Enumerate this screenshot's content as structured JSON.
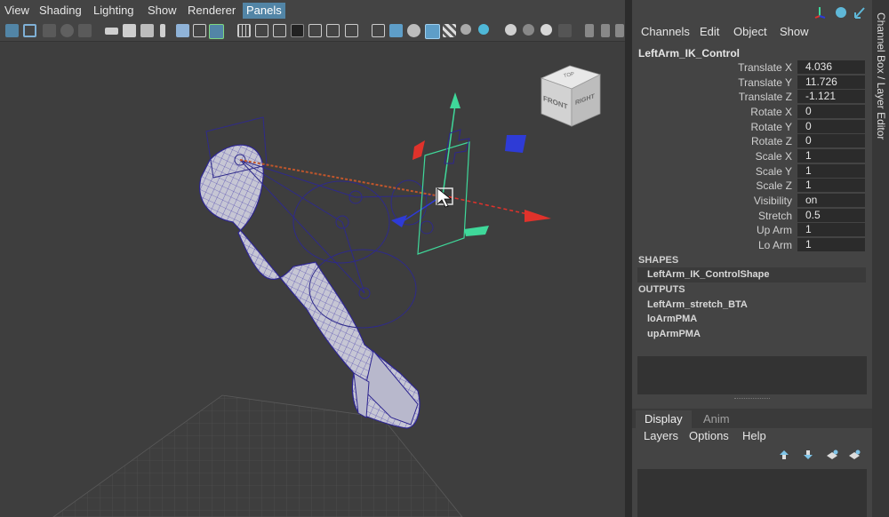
{
  "viewport": {
    "menus": [
      "View",
      "Shading",
      "Lighting",
      "Show",
      "Renderer",
      "Panels"
    ],
    "active_menu": "Panels",
    "view_cube": {
      "top": "TOP",
      "front": "FRONT",
      "right": "RIGHT"
    }
  },
  "channel_box": {
    "side_tab": "Channel Box / Layer Editor",
    "menus": [
      "Channels",
      "Edit",
      "Object",
      "Show"
    ],
    "object_name": "LeftArm_IK_Control",
    "attributes": [
      {
        "label": "Translate X",
        "value": "4.036"
      },
      {
        "label": "Translate Y",
        "value": "11.726"
      },
      {
        "label": "Translate Z",
        "value": "-1.121"
      },
      {
        "label": "Rotate X",
        "value": "0"
      },
      {
        "label": "Rotate Y",
        "value": "0"
      },
      {
        "label": "Rotate Z",
        "value": "0"
      },
      {
        "label": "Scale X",
        "value": "1"
      },
      {
        "label": "Scale Y",
        "value": "1"
      },
      {
        "label": "Scale Z",
        "value": "1"
      },
      {
        "label": "Visibility",
        "value": "on"
      },
      {
        "label": "Stretch",
        "value": "0.5"
      },
      {
        "label": "Up Arm",
        "value": "1"
      },
      {
        "label": "Lo Arm",
        "value": "1"
      }
    ],
    "shapes_header": "SHAPES",
    "shape_item": "LeftArm_IK_ControlShape",
    "outputs_header": "OUTPUTS",
    "outputs": [
      "LeftArm_stretch_BTA",
      "loArmPMA",
      "upArmPMA"
    ]
  },
  "layer_editor": {
    "tabs": [
      "Display",
      "Anim"
    ],
    "active_tab": "Display",
    "menus": [
      "Layers",
      "Options",
      "Help"
    ]
  },
  "colors": {
    "accent": "#5285a6",
    "panel_bg": "#444444",
    "viewport_bg": "#3e3e3e",
    "mesh_wire": "#3a2fa8",
    "mesh_fill": "#c6c6d4",
    "manip_x": "#e0322b",
    "manip_y": "#3fd89a",
    "manip_z": "#2e3bd6"
  }
}
